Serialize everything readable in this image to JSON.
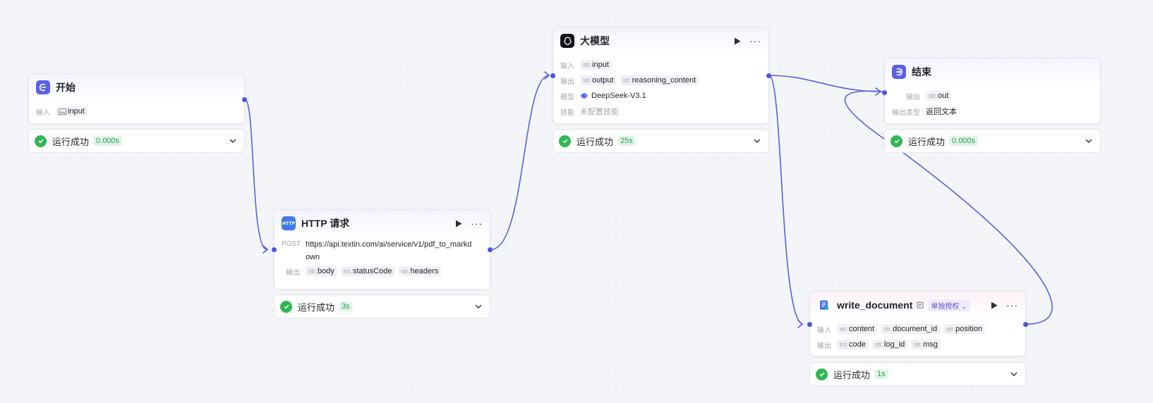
{
  "colors": {
    "accent": "#4a55e0",
    "success": "#2fb653",
    "badge_bg": "#e3f6e8",
    "edge": "#5a60e0"
  },
  "nodes": {
    "start": {
      "icon": "start-icon",
      "title": "开始",
      "input_label": "输入",
      "input_param": "input",
      "status": "运行成功",
      "time": "0.000s"
    },
    "http": {
      "icon": "http-icon",
      "title": "HTTP 请求",
      "method": "POST",
      "url": "https://api.textin.com/ai/service/v1/pdf_to_markdown",
      "output_label": "输出",
      "outputs": [
        {
          "type": "str.",
          "name": "body"
        },
        {
          "type": "int.",
          "name": "statusCode"
        },
        {
          "type": "str.",
          "name": "headers"
        }
      ],
      "status": "运行成功",
      "time": "3s"
    },
    "llm": {
      "icon": "llm-icon",
      "title": "大模型",
      "input_label": "输入",
      "inputs": [
        {
          "type": "str.",
          "name": "input"
        }
      ],
      "output_label": "输出",
      "outputs": [
        {
          "type": "str.",
          "name": "output"
        },
        {
          "type": "str.",
          "name": "reasoning_content"
        }
      ],
      "model_label": "模型",
      "model": "DeepSeek-V3.1",
      "skill_label": "技能",
      "skill": "未配置技能",
      "status": "运行成功",
      "time": "25s"
    },
    "end": {
      "icon": "end-icon",
      "title": "结束",
      "output_label": "输出",
      "outputs": [
        {
          "type": "str.",
          "name": "out"
        }
      ],
      "output_type_label": "输出类型",
      "output_type": "返回文本",
      "status": "运行成功",
      "time": "0.000s"
    },
    "write": {
      "icon": "document-icon",
      "title": "write_document",
      "auth": "单独授权",
      "input_label": "输入",
      "inputs": [
        {
          "type": "str.",
          "name": "content"
        },
        {
          "type": "str.",
          "name": "document_id"
        },
        {
          "type": "str.",
          "name": "position"
        }
      ],
      "output_label": "输出",
      "outputs": [
        {
          "type": "int.",
          "name": "code"
        },
        {
          "type": "str.",
          "name": "log_id"
        },
        {
          "type": "str.",
          "name": "msg"
        }
      ],
      "status": "运行成功",
      "time": "1s"
    }
  }
}
